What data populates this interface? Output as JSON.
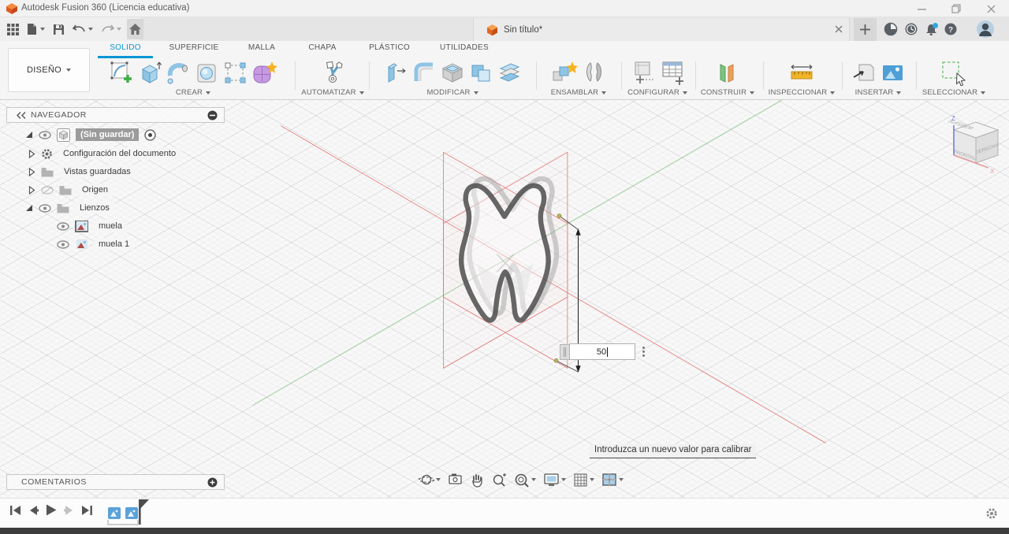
{
  "window": {
    "title": "Autodesk Fusion 360 (Licencia educativa)"
  },
  "document_tab": {
    "label": "Sin título*"
  },
  "design_menu": {
    "label": "DISEÑO"
  },
  "tabs": [
    {
      "label": "SOLIDO",
      "active": true
    },
    {
      "label": "SUPERFICIE"
    },
    {
      "label": "MALLA"
    },
    {
      "label": "CHAPA"
    },
    {
      "label": "PLÁSTICO"
    },
    {
      "label": "UTILIDADES"
    }
  ],
  "ribbon_groups": [
    {
      "label": "CREAR"
    },
    {
      "label": "AUTOMATIZAR"
    },
    {
      "label": "MODIFICAR"
    },
    {
      "label": "ENSAMBLAR"
    },
    {
      "label": "CONFIGURAR"
    },
    {
      "label": "CONSTRUIR"
    },
    {
      "label": "INSPECCIONAR"
    },
    {
      "label": "INSERTAR"
    },
    {
      "label": "SELECCIONAR"
    }
  ],
  "navigator": {
    "title": "NAVEGADOR",
    "items": [
      {
        "label": "(Sin guardar)",
        "type": "document",
        "selected": true,
        "visible": true
      },
      {
        "label": "Configuración del documento",
        "type": "settings"
      },
      {
        "label": "Vistas guardadas",
        "type": "folder"
      },
      {
        "label": "Origen",
        "type": "folder",
        "visible": false
      },
      {
        "label": "Lienzos",
        "type": "folder",
        "visible": true,
        "expanded": true
      },
      {
        "label": "muela",
        "type": "canvas-image",
        "visible": true,
        "selected_thumb": true
      },
      {
        "label": "muela 1",
        "type": "canvas-image",
        "visible": true
      }
    ]
  },
  "viewcube": {
    "top": "SUPERIOR",
    "front": "FRONTAL",
    "right": "DERECHA",
    "axis_z": "Z",
    "axis_x": "X"
  },
  "dimension": {
    "value": "50",
    "tooltip": "Introduzca un nuevo valor para calibrar"
  },
  "comments": {
    "title": "COMENTARIOS"
  },
  "icons": {
    "help_glyph": "?",
    "quick_access": [
      "apps-grid",
      "file",
      "save",
      "undo",
      "redo",
      "home"
    ],
    "top_right": [
      "extensions",
      "job-status",
      "notifications",
      "help",
      "avatar"
    ],
    "nav_toolbar": [
      "orbit",
      "look-at",
      "pan",
      "zoom",
      "zoom-window",
      "display-settings",
      "grid-settings",
      "viewports"
    ],
    "playback": [
      "go-to-start",
      "step-back",
      "play",
      "step-forward",
      "go-to-end"
    ]
  },
  "colors": {
    "accent": "#0a96d4",
    "plane_red": "#e57373",
    "axis_green": "#97d097",
    "logo_orange": "#f0652e"
  }
}
